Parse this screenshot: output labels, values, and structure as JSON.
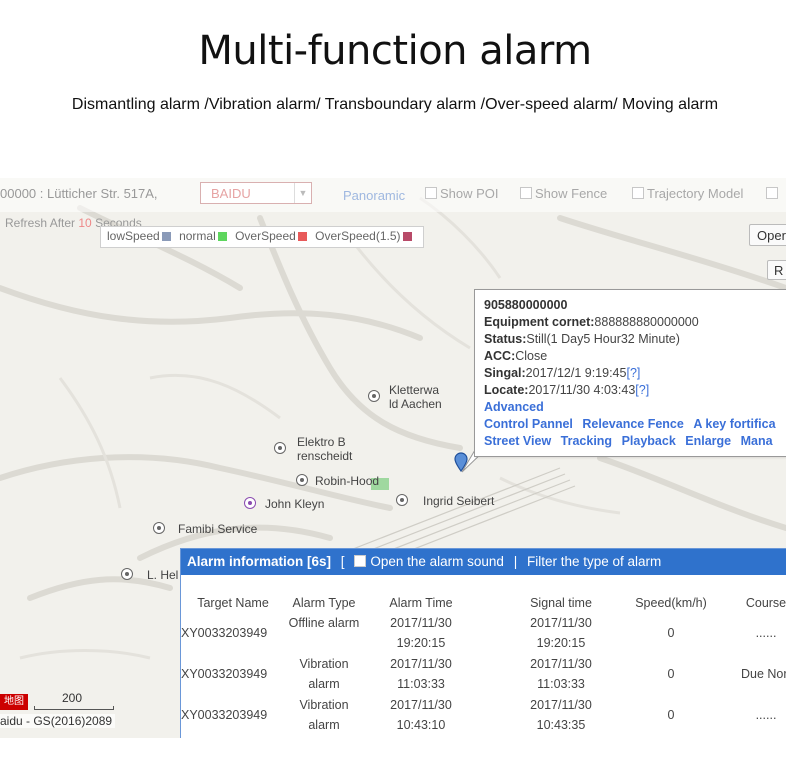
{
  "title": "Multi-function alarm",
  "subtitle": "Dismantling alarm /Vibration alarm/ Transboundary alarm /Over-speed alarm/ Moving alarm",
  "toolbar": {
    "address": "00000 : Lütticher Str. 517A,",
    "map_select": "BAIDU",
    "panoramic": "Panoramic",
    "show_poi": "Show POI",
    "show_fence": "Show Fence",
    "trajectory_model": "Trajectory Model",
    "open_button": "Oper",
    "r_button": "R"
  },
  "refresh": {
    "prefix": "Refresh After",
    "seconds": "10",
    "suffix": "Seconds"
  },
  "legend": [
    {
      "label": "lowSpeed",
      "color": "#8a9ab8"
    },
    {
      "label": "normal",
      "color": "#5ed65e"
    },
    {
      "label": "OverSpeed",
      "color": "#e85a5a"
    },
    {
      "label": "OverSpeed(1.5)",
      "color": "#b84a68"
    }
  ],
  "pois": {
    "kletterwa": [
      "Kletterwa",
      "ld Aachen"
    ],
    "elektro": [
      "Elektro B",
      "renscheidt"
    ],
    "robin": "Robin-Hood",
    "john": "John Kleyn",
    "ingrid": "Ingrid Seibert",
    "famibi": "Famibi Service",
    "lhel": "L. Hel"
  },
  "popup": {
    "device_id": "905880000000",
    "equipment_label": "Equipment cornet:",
    "equipment_value": "888888880000000",
    "status_label": "Status:",
    "status_value": "Still(1 Day5 Hour32 Minute)",
    "acc_label": "ACC:",
    "acc_value": "Close",
    "signal_label": "Singal:",
    "signal_value": "2017/12/1 9:19:45",
    "locate_label": "Locate:",
    "locate_value": "2017/11/30 4:03:43",
    "q": "[?]",
    "advanced": "Advanced",
    "links_row1": [
      "Control Pannel",
      "Relevance Fence",
      "A key fortifica"
    ],
    "links_row2": [
      "Street View",
      "Tracking",
      "Playback",
      "Enlarge",
      "Mana"
    ]
  },
  "scale": {
    "logo": "地图",
    "distance": "200",
    "copyright": "aidu - GS(2016)2089"
  },
  "alarm": {
    "title": "Alarm information [6s]",
    "bracket": "[",
    "open_sound": "Open the alarm sound",
    "divider": "|",
    "filter": "Filter the type of alarm",
    "columns": [
      "Target Name",
      "Alarm Type",
      "Alarm Time",
      "Signal time",
      "Speed(km/h)",
      "Course"
    ],
    "rows": [
      {
        "target": "XY0033203949",
        "type": [
          "Offline alarm",
          ""
        ],
        "alarm_time": [
          "2017/11/30",
          "19:20:15"
        ],
        "signal_time": [
          "2017/11/30",
          "19:20:15"
        ],
        "speed": "0",
        "course": "......"
      },
      {
        "target": "XY0033203949",
        "type": [
          "Vibration",
          "alarm"
        ],
        "alarm_time": [
          "2017/11/30",
          "11:03:33"
        ],
        "signal_time": [
          "2017/11/30",
          "11:03:33"
        ],
        "speed": "0",
        "course": "Due Nort"
      },
      {
        "target": "XY0033203949",
        "type": [
          "Vibration",
          "alarm"
        ],
        "alarm_time": [
          "2017/11/30",
          "10:43:10"
        ],
        "signal_time": [
          "2017/11/30",
          "10:43:35"
        ],
        "speed": "0",
        "course": "......"
      }
    ]
  }
}
